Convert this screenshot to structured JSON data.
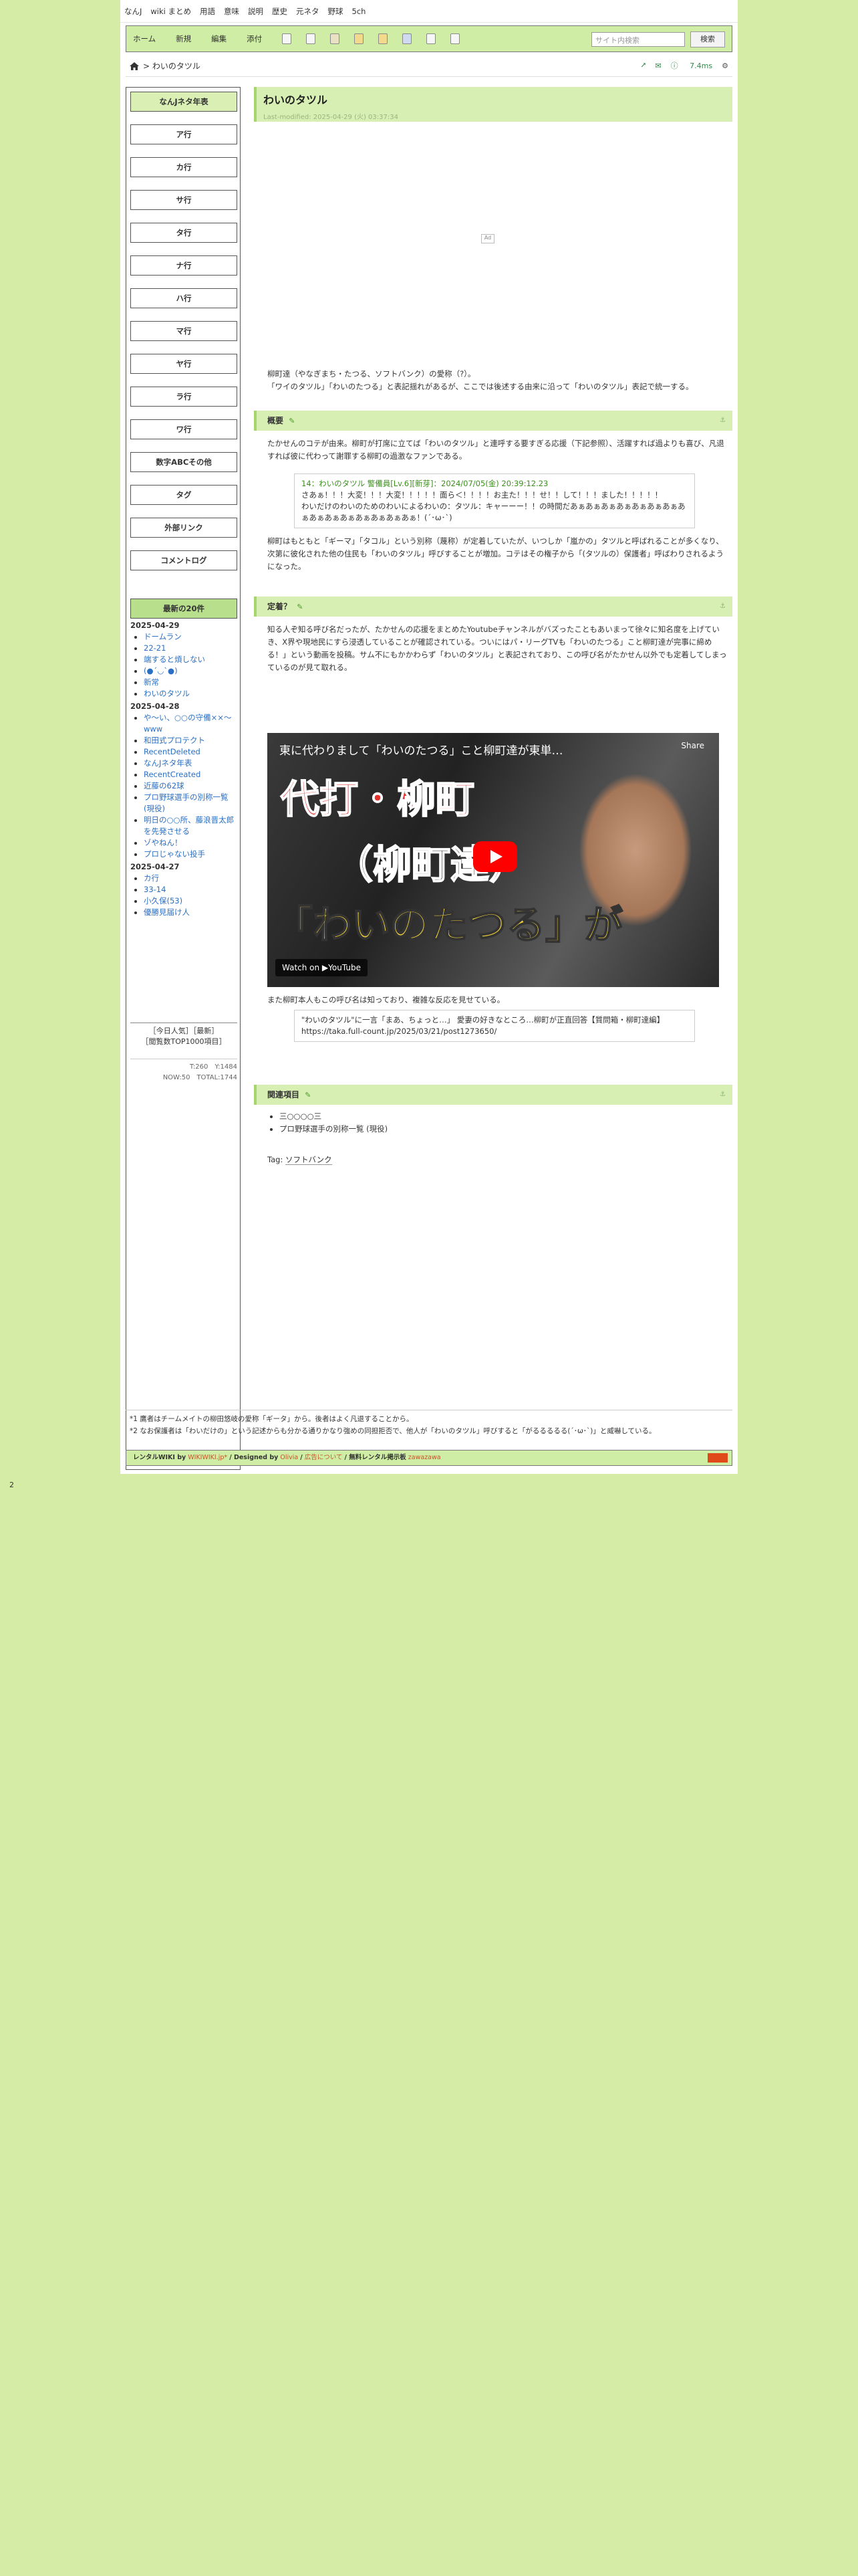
{
  "topbar": [
    "なんJ",
    "wiki まとめ",
    "用語",
    "意味",
    "説明",
    "歴史",
    "元ネタ",
    "野球",
    "5ch"
  ],
  "navbar": {
    "items": [
      "ホーム",
      "新規",
      "編集",
      "添付"
    ],
    "search_placeholder": "サイト内検索",
    "search_button": "検索"
  },
  "breadcrumb": "> わいのタツル",
  "tools": {
    "time": "7.4ms"
  },
  "sidebar": {
    "menu": [
      "なんJネタ年表",
      "ア行",
      "カ行",
      "サ行",
      "タ行",
      "ナ行",
      "ハ行",
      "マ行",
      "ヤ行",
      "ラ行",
      "ワ行",
      "数字ABCその他",
      "タグ",
      "外部リンク",
      "コメントログ"
    ],
    "recent_head": "最新の20件",
    "recent": [
      {
        "date": "2025-04-29",
        "items": [
          "ドームラン",
          "22-21",
          "端すると煩しない",
          "(●´◡`●)",
          "新常",
          "わいのタツル"
        ]
      },
      {
        "date": "2025-04-28",
        "items": [
          "や～い、○○の守備××～www",
          "和田式プロテクト",
          "RecentDeleted",
          "なんJネタ年表",
          "RecentCreated",
          "近藤の62球",
          "プロ野球選手の別称一覧 (現役)",
          "明日の○○所、藤浪晋太郎を先発させる",
          "ゾやねん！",
          "プロじゃない投手"
        ]
      },
      {
        "date": "2025-04-27",
        "items": [
          "カ行",
          "33-14",
          "小久保(53)",
          "優勝見届け人"
        ]
      }
    ],
    "rank": [
      "［今日人気］［最新］",
      "［閲覧数TOP1000項目］"
    ],
    "counter": [
      "T:260　Y:1484",
      "NOW:50　TOTAL:1744"
    ]
  },
  "main": {
    "title": "わいのタツル",
    "last_modified": "Last-modified: 2025-04-29 (火) 03:37:34",
    "ad_label": "Ad",
    "intro": [
      "柳町達（やなぎまち・たつる、ソフトバンク）の愛称（?）。",
      "「ワイのタツル」「わいのたつる」と表記揺れがあるが、ここでは後述する由来に沿って「わいのタツル」表記で統一する。"
    ],
    "s1_title": "概要",
    "s1_p1": "たかせんのコテが由来。柳町が打席に立てば「わいのタツル」と連呼する要すぎる応援（下記参照）、活躍すれば過よりも喜び、凡退すれば彼に代わって謝罪する柳町の過激なファンである。",
    "quote1_head": "14：わいのタツル 警備員[Lv.6][新芽]：2024/07/05(金) 20:39:12.23",
    "quote1_lines": [
      "さあぁ！！！大変！！！大変！！！！！面ら＜！！！！お主た！！！せ！！して！！！ました！！！！！",
      "わいだけのわいのためのわいによるわいの：タツル：キャーーー！！の時間だあぁあぁあぁあぁあぁあぁあぁあぁあぁあぁあぁあぁあぁあぁあぁ！(´･ω･`)"
    ],
    "s1_p2": "柳町はもともと「ギーマ」「タコル」という別称（蔑称）が定着していたが、いつしか「嵐かの」タツルと呼ばれることが多くなり、次第に彼化された他の住民も「わいのタツル」呼びすることが増加。コテはその権子から「(タツルの）保護者」呼ばわりされるようになった。",
    "s2_title": "定着？",
    "s2_p": "知る人ぞ知る呼び名だったが、たかせんの応援をまとめたYoutubeチャンネルがバズったこともあいまって徐々に知名度を上げていき、X界や現地民にすら浸透していることが確認されている。ついにはパ・リーグTVも「わいのたつる」こと柳町達が完事に締める！」という動画を投稿。サム不にもかかわらず「わいのタツル」と表記されており、この呼び名がたかせん以外でも定着してしまっているのが見て取れる。",
    "video": {
      "title": "東に代わりまして「わいのたつる」こと柳町達が東単…",
      "share": "Share",
      "line1": "代打・柳町",
      "line2": "（柳町達）",
      "line3": "「わいのたつる」が",
      "watch": "Watch on ▶YouTube"
    },
    "s2_p2": "また柳町本人もこの呼び名は知っており、複雑な反応を見せている。",
    "quote2_lines": [
      "\"わいのタツル\"に一言「まあ、ちょっと…」 愛妻の好きなところ…柳町が正直回答【質問箱・柳町達編】",
      "https://taka.full-count.jp/2025/03/21/post1273650/"
    ],
    "s3_title": "関連項目",
    "related": [
      "三○○○○三",
      "プロ野球選手の別称一覧 (現役)"
    ],
    "tag_label": "Tag:",
    "tag": "ソフトバンク",
    "footnotes": [
      "*1 鷹者はチームメイトの柳田悠岐の愛称「ギータ」から。後者はよく凡退することから。",
      "*2 なお保護者は「わいだけの」という記述からも分かる通りかなり強めの同担拒否で、他人が「わいのタツル」呼びすると「がるるるるる(´･ω･`)」と威嚇している。"
    ],
    "footer": {
      "text1": "レンタルWIKI by",
      "link1": "WIKIWIKI.jp*",
      "text2": "/ Designed by",
      "link2": "Olivia",
      "text3": "/",
      "link3": "広告について",
      "text4": "/ 無料レンタル掲示板",
      "link4": "zawazawa"
    }
  },
  "page_number": "2",
  "colors": {
    "page_bg": "#d4eca6",
    "nav_bg": "#cfeda4",
    "heading_bg": "#d8efb4",
    "accent": "#a6d46e"
  }
}
